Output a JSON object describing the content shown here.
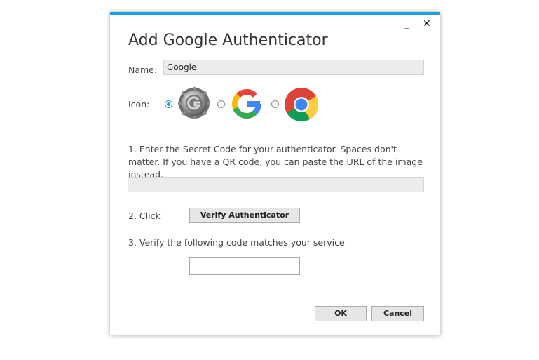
{
  "window": {
    "title": "Add Google Authenticator",
    "minimize_glyph": "_",
    "close_glyph": "✕",
    "accent_color": "#1ba1e2"
  },
  "name": {
    "label": "Name:",
    "value": "Google"
  },
  "icon": {
    "label": "Icon:",
    "options": [
      {
        "id": "authenticator-coin",
        "selected": true
      },
      {
        "id": "google-g",
        "selected": false
      },
      {
        "id": "chrome",
        "selected": false
      }
    ]
  },
  "step1": {
    "text": "1. Enter the Secret Code for your authenticator. Spaces don't matter. If you have a QR code, you can paste the URL of the image instead.",
    "secret_value": ""
  },
  "step2": {
    "label": "2. Click",
    "button_label": "Verify Authenticator"
  },
  "step3": {
    "label": "3. Verify the following code matches your service",
    "code_value": ""
  },
  "footer": {
    "ok_label": "OK",
    "cancel_label": "Cancel"
  }
}
